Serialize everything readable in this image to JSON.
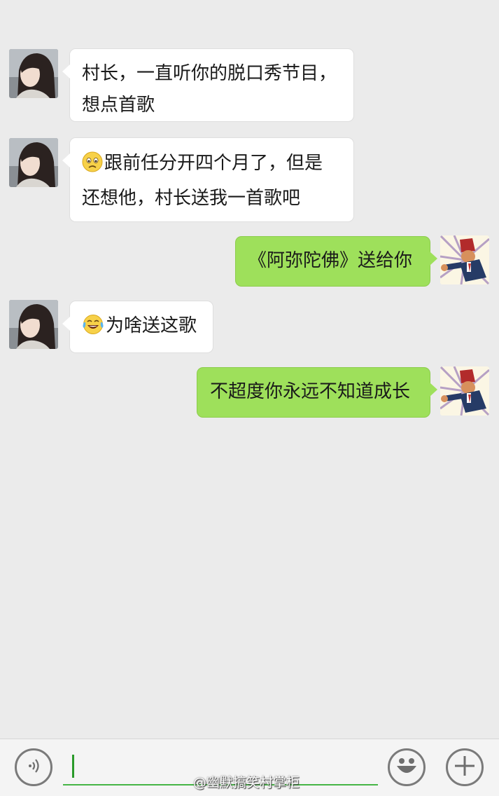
{
  "messages": [
    {
      "id": 1,
      "from": "other",
      "text": "村长，一直听你的脱口秀节目，想点首歌"
    },
    {
      "id": 2,
      "from": "other",
      "emoji": "worried-face",
      "text": "跟前任分开四个月了，但是还想他，村长送我一首歌吧"
    },
    {
      "id": 3,
      "from": "me",
      "text": "《阿弥陀佛》送给你"
    },
    {
      "id": 4,
      "from": "other",
      "emoji": "tears-of-joy-face",
      "text": "为啥送这歌"
    },
    {
      "id": 5,
      "from": "me",
      "text": "不超度你永远不知道成长"
    }
  ],
  "input_bar": {
    "voice_icon": "voice-icon",
    "emoji_icon": "smiley-icon",
    "more_icon": "plus-icon",
    "input_value": ""
  },
  "watermark": "@幽默搞笑村掌柜",
  "colors": {
    "background": "#ebebeb",
    "incoming_bubble": "#ffffff",
    "outgoing_bubble": "#9ee05b",
    "input_underline": "#45b545"
  }
}
